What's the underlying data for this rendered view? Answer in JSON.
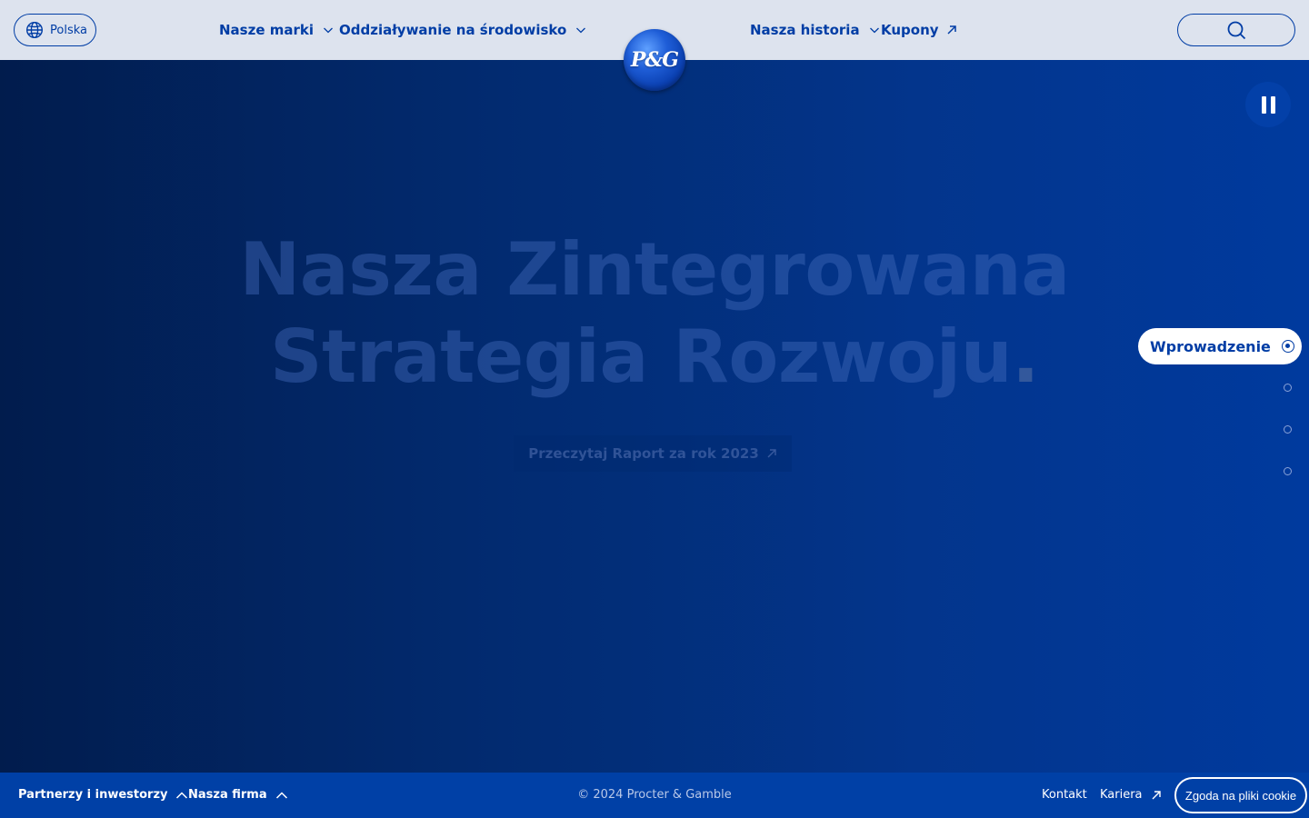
{
  "header": {
    "language_label": "Polska",
    "nav": [
      {
        "label": "Nasze marki",
        "icon": "chevron-down-icon"
      },
      {
        "label": "Oddziaływanie na środowisko",
        "icon": "chevron-down-icon"
      },
      {
        "label": "Nasza historia",
        "icon": "chevron-down-icon"
      },
      {
        "label": "Kupony",
        "icon": "external-arrow-icon"
      }
    ],
    "logo_text": "P&G",
    "search_icon": "search-icon"
  },
  "hero": {
    "title_line1": "Nasza Zintegrowana",
    "title_line2": "Strategia Rozwoju",
    "title_dot": ".",
    "cta_label": "Przeczytaj Raport za rok 2023",
    "pause_icon": "pause-icon"
  },
  "section_nav": {
    "active_label": "Wprowadzenie",
    "dots_count": 3
  },
  "footer": {
    "partners_label": "Partnerzy i inwestorzy",
    "company_label": "Nasza firma",
    "copyright": "© 2024 Procter & Gamble",
    "contact_label": "Kontakt",
    "career_label": "Kariera",
    "cookie_label": "Zgoda na pliki cookie"
  },
  "colors": {
    "brand_blue": "#003da5",
    "header_bg": "#dde3ee",
    "footer_bg": "#0040a6"
  }
}
